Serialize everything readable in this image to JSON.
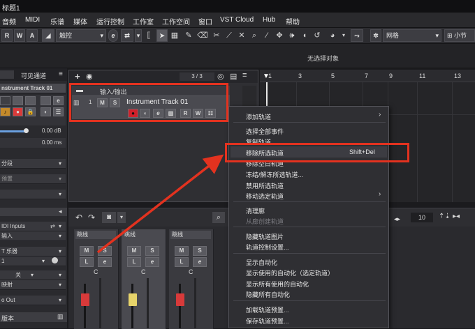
{
  "window": {
    "title": "标题1"
  },
  "menubar": {
    "items": [
      "音频",
      "MIDI",
      "乐谱",
      "媒体",
      "运行控制",
      "工作室",
      "工作空间",
      "窗口",
      "VST Cloud",
      "Hub",
      "帮助"
    ]
  },
  "toolbar": {
    "r": "R",
    "w": "W",
    "a": "A",
    "touch_mode": "触控",
    "e_label": "e",
    "grid_label": "网格",
    "bar_label": "小节"
  },
  "infobar": {
    "no_selection": "无选择对象"
  },
  "inspector": {
    "tab_visible_channels": "可见通道",
    "track_name": "nstrument Track 01",
    "volume": "0.00 dB",
    "delay": "0.00 ms",
    "section_1": "分段",
    "section_2": "预置",
    "midi_inputs": "IDI Inputs",
    "input_label": "输入",
    "instrument_label": "T 乐器",
    "channel": "1",
    "off_label": "关",
    "map_label": "映射",
    "output": "o Out",
    "version_label": "版本"
  },
  "tracklist": {
    "counter": "3 / 3",
    "folder_track_name": "输入/输出",
    "instrument_track_number": "1",
    "instrument_track_name": "Instrument Track 01",
    "m": "M",
    "s": "S",
    "e": "e",
    "r": "R",
    "w": "W"
  },
  "ruler": {
    "bars": [
      "1",
      "3",
      "5",
      "7",
      "9",
      "11",
      "13"
    ]
  },
  "mixer": {
    "zoom_value": "10",
    "strips": [
      {
        "name": "跳线",
        "m": "M",
        "s": "S",
        "l": "L",
        "e": "e",
        "c": "C"
      },
      {
        "name": "跳线",
        "m": "M",
        "s": "S",
        "l": "L",
        "e": "e",
        "c": "C"
      },
      {
        "name": "跳线",
        "m": "M",
        "s": "S",
        "l": "L",
        "e": "e",
        "c": "C"
      }
    ]
  },
  "context_menu": {
    "items": [
      {
        "label": "添加轨道",
        "submenu": true
      },
      {
        "label": "选择全部事件"
      },
      {
        "label": "复制轨道"
      },
      {
        "label": "移除所选轨道",
        "shortcut": "Shift+Del",
        "highlighted": true
      },
      {
        "label": "移除空白轨道"
      },
      {
        "label": "冻结/解冻所选轨道..."
      },
      {
        "label": "禁用所选轨道"
      },
      {
        "label": "移动选定轨道",
        "submenu": true
      },
      {
        "label": "清理廊"
      },
      {
        "label": "从廊创建轨道",
        "disabled": true
      },
      {
        "label": "隐藏轨道图片"
      },
      {
        "label": "轨道控制设置..."
      },
      {
        "label": "显示自动化"
      },
      {
        "label": "显示使用的自动化（选定轨道）"
      },
      {
        "label": "显示所有使用的自动化"
      },
      {
        "label": "隐藏所有自动化"
      },
      {
        "label": "加载轨道预置..."
      },
      {
        "label": "保存轨道预置..."
      }
    ]
  },
  "colors": {
    "annotation_red": "#e3321f",
    "record_red": "#d0202a",
    "fader_red": "#d83a3a",
    "fader_yellow": "#e6d36a"
  }
}
